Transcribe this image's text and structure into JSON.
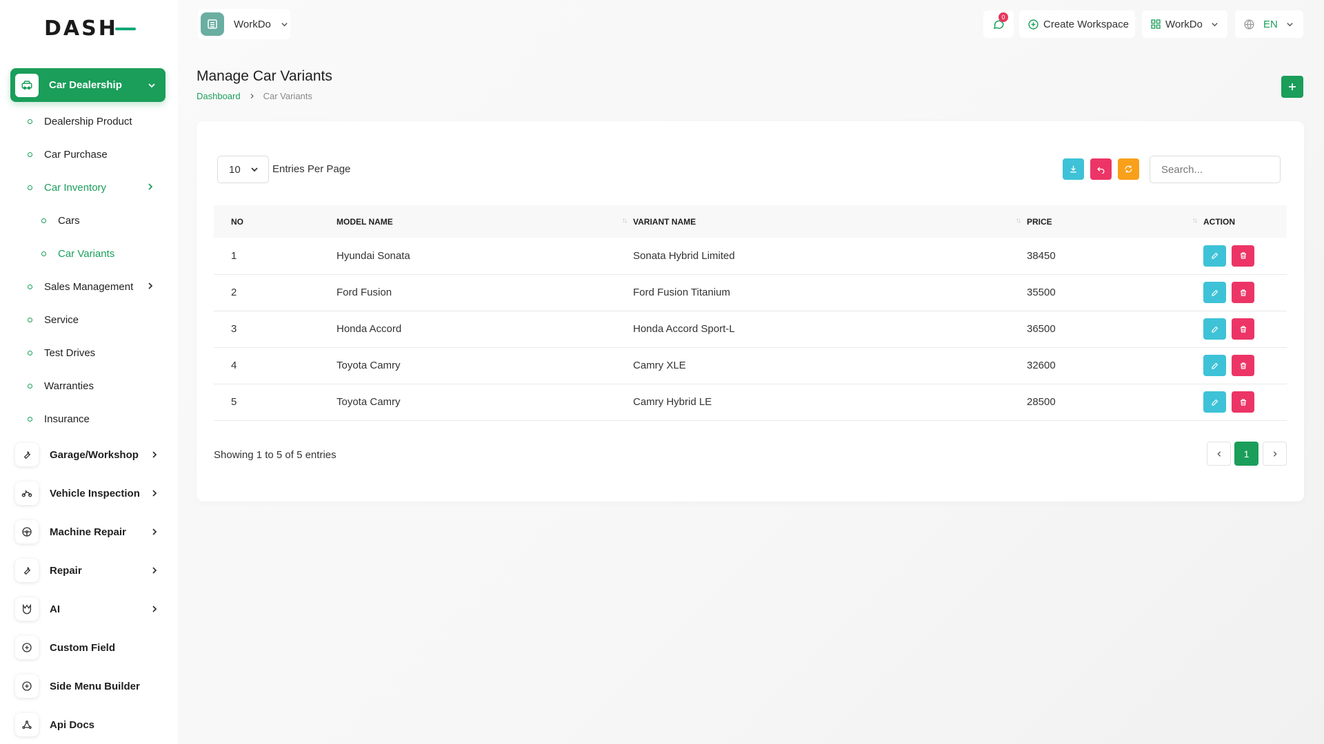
{
  "brand": {
    "logo_text": "DASH"
  },
  "sidebar": {
    "active_module": "Car Dealership",
    "sub_items": [
      {
        "label": "Dealership Product"
      },
      {
        "label": "Car Purchase"
      },
      {
        "label": "Car Inventory"
      },
      {
        "label": "Cars"
      },
      {
        "label": "Car Variants"
      },
      {
        "label": "Sales Management"
      },
      {
        "label": "Service"
      },
      {
        "label": "Test Drives"
      },
      {
        "label": "Warranties"
      },
      {
        "label": "Insurance"
      }
    ],
    "modules": [
      {
        "label": "Garage/Workshop",
        "icon": "wrench-icon"
      },
      {
        "label": "Vehicle Inspection",
        "icon": "motorbike-icon"
      },
      {
        "label": "Machine Repair",
        "icon": "steering-wheel-icon"
      },
      {
        "label": "Repair",
        "icon": "wrench-icon"
      },
      {
        "label": "AI",
        "icon": "ai-icon"
      },
      {
        "label": "Custom Field",
        "icon": "plus-circle-icon"
      },
      {
        "label": "Side Menu Builder",
        "icon": "plus-circle-icon"
      },
      {
        "label": "Api Docs",
        "icon": "api-icon"
      }
    ]
  },
  "header": {
    "workspace_name": "WorkDo",
    "notification_count": "0",
    "create_workspace_label": "Create Workspace",
    "workspace_switch_label": "WorkDo",
    "language": "EN"
  },
  "page": {
    "title": "Manage Car Variants",
    "breadcrumb_home": "Dashboard",
    "breadcrumb_current": "Car Variants"
  },
  "table": {
    "entries_per_page": "10",
    "entries_label": "Entries Per Page",
    "search_placeholder": "Search...",
    "columns": [
      "NO",
      "MODEL NAME",
      "VARIANT NAME",
      "PRICE",
      "ACTION"
    ],
    "rows": [
      {
        "no": "1",
        "model": "Hyundai Sonata",
        "variant": "Sonata Hybrid Limited",
        "price": "38450"
      },
      {
        "no": "2",
        "model": "Ford Fusion",
        "variant": "Ford Fusion Titanium",
        "price": "35500"
      },
      {
        "no": "3",
        "model": "Honda Accord",
        "variant": "Honda Accord Sport-L",
        "price": "36500"
      },
      {
        "no": "4",
        "model": "Toyota Camry",
        "variant": "Camry XLE",
        "price": "32600"
      },
      {
        "no": "5",
        "model": "Toyota Camry",
        "variant": "Camry Hybrid LE",
        "price": "28500"
      }
    ],
    "showing_text": "Showing 1 to 5 of 5 entries",
    "current_page": "1"
  },
  "colors": {
    "accent": "#1a9e5a",
    "edit": "#3ec2d7",
    "delete": "#ec3566",
    "refresh": "#f9a01b",
    "export": "#3ec2d7",
    "reset": "#ec3566"
  }
}
